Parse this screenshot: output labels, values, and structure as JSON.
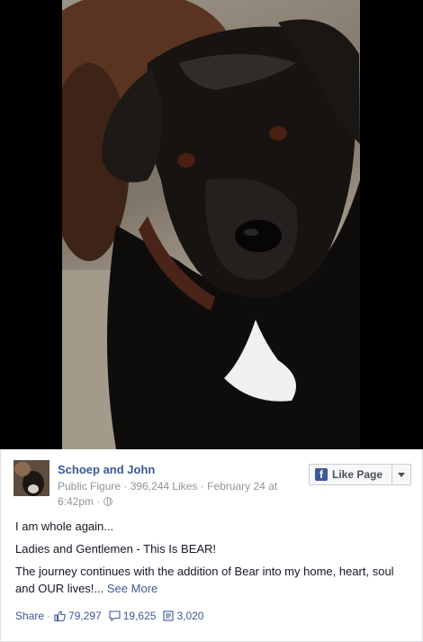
{
  "post": {
    "page_name": "Schoep and John",
    "category": "Public Figure",
    "likes": "396,244 Likes",
    "date_line1": "February 24 at",
    "date_line2": "6:42pm",
    "separator": "·",
    "like_button_label": "Like Page",
    "paragraphs": [
      "I am whole again...",
      "Ladies and Gentlemen - This Is BEAR!"
    ],
    "body_text": "The journey continues with the addition of Bear into my home, heart, soul and OUR lives!...",
    "see_more": "See More",
    "share_label": "Share",
    "like_count": "79,297",
    "comment_count": "19,625",
    "share_count": "3,020"
  },
  "icons": {
    "brand": "facebook-icon",
    "privacy": "globe-icon",
    "like": "thumbs-up-icon",
    "comment": "comment-icon",
    "share": "share-icon",
    "menu": "chevron-down-icon"
  },
  "colors": {
    "link": "#3b5998",
    "meta": "#90949c",
    "frame": "#000000"
  }
}
